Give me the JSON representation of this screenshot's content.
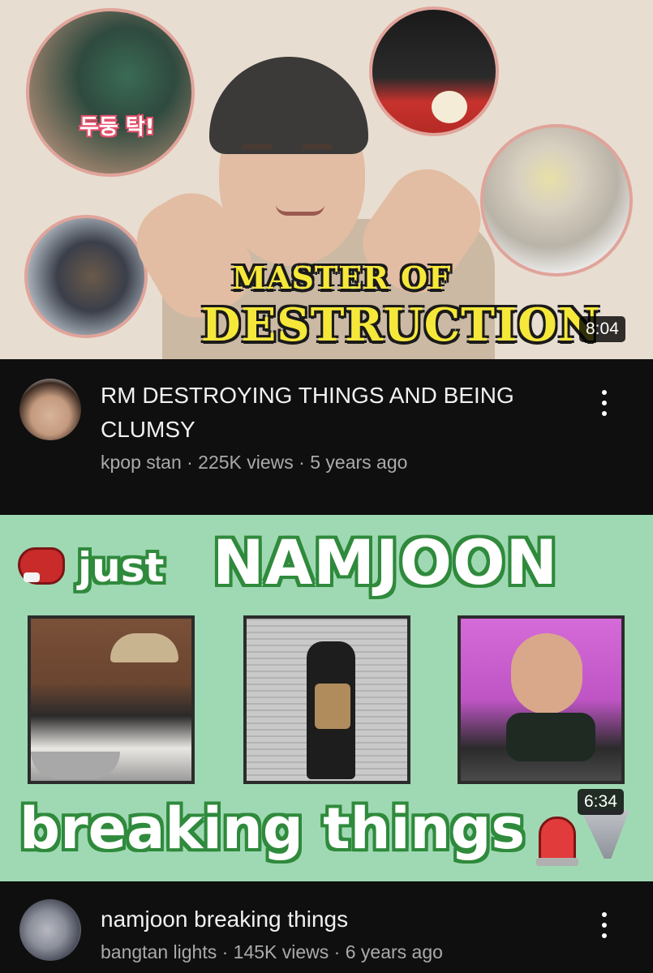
{
  "videos": [
    {
      "thumbnail": {
        "title_line1": "MASTER OF",
        "title_line2": "DESTRUCTION",
        "inset_caption": "두둥 탁!",
        "duration": "8:04"
      },
      "title": "RM DESTROYING THINGS AND BEING CLUMSY",
      "channel": "kpop stan",
      "meta": "kpop stan · 225K views · 5 years ago"
    },
    {
      "thumbnail": {
        "top_word_small": "just",
        "top_word_big": "NAMJOON",
        "bottom_text": "breaking things",
        "icons": [
          "boxing-glove-icon",
          "siren-icon",
          "tornado-icon"
        ],
        "duration": "6:34"
      },
      "title": "namjoon breaking things",
      "channel": "bangtan lights",
      "meta": "bangtan lights · 145K views · 6 years ago"
    }
  ],
  "colors": {
    "background": "#0f0f0f",
    "title_text": "#f1f1f1",
    "meta_text": "#aaaaaa",
    "thumb1_bg": "#e8ddd1",
    "thumb1_title": "#f6e83a",
    "thumb2_bg": "#9fd9b3",
    "thumb2_outline": "#2f8a3c"
  }
}
